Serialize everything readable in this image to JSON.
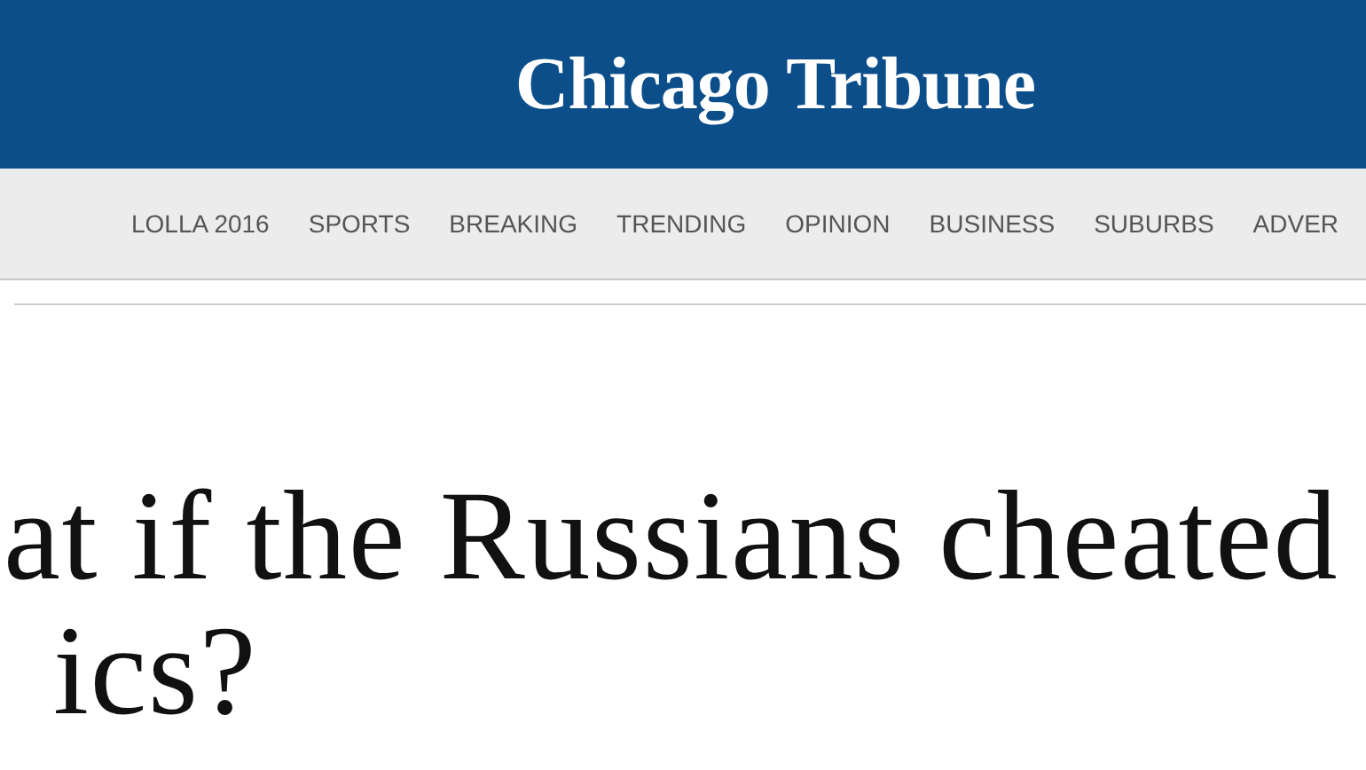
{
  "header": {
    "logo": "Chicago Tribune"
  },
  "nav": {
    "items": [
      {
        "label": "LOLLA 2016"
      },
      {
        "label": "SPORTS"
      },
      {
        "label": "BREAKING"
      },
      {
        "label": "TRENDING"
      },
      {
        "label": "OPINION"
      },
      {
        "label": "BUSINESS"
      },
      {
        "label": "SUBURBS"
      },
      {
        "label": "ADVER"
      }
    ]
  },
  "headline": {
    "lines": [
      "at if the Russians cheated",
      "ics?"
    ]
  }
}
